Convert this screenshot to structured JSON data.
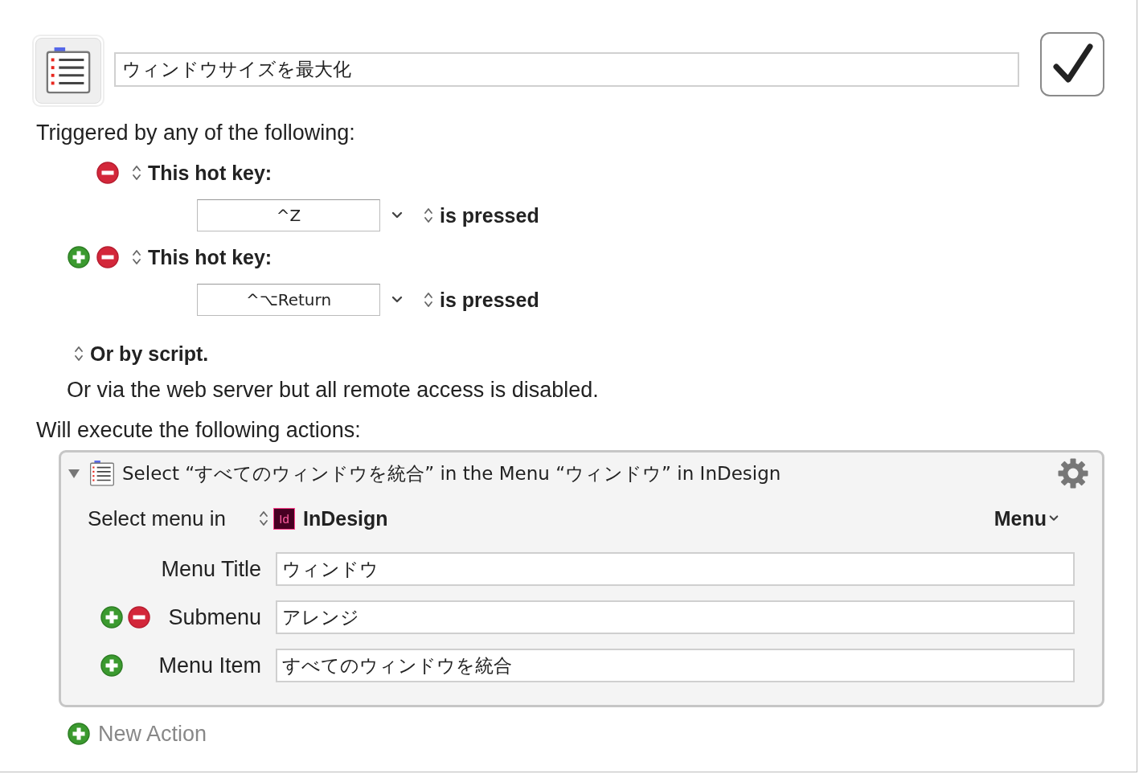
{
  "macro": {
    "name": "ウィンドウサイズを最大化",
    "enabled": true
  },
  "trigger_heading": "Triggered by any of the following:",
  "triggers": [
    {
      "label": "This hot key:",
      "can_add": false,
      "can_remove": true,
      "key": "^Z",
      "condition": "is pressed"
    },
    {
      "label": "This hot key:",
      "can_add": true,
      "can_remove": true,
      "key": "^⌥Return",
      "condition": "is pressed"
    }
  ],
  "script_trigger": "Or by script.",
  "web_server_note": "Or via the web server but all remote access is disabled.",
  "actions_heading": "Will execute the following actions:",
  "actions": [
    {
      "title": "Select “すべてのウィンドウを統合” in the Menu “ウィンドウ” in InDesign",
      "expanded": true,
      "select_label": "Select menu in",
      "app_badge": "Id",
      "app": "InDesign",
      "mode": "Menu",
      "fields": [
        {
          "label": "Menu Title",
          "value": "ウィンドウ",
          "can_add": false,
          "can_remove": false
        },
        {
          "label": "Submenu",
          "value": "アレンジ",
          "can_add": true,
          "can_remove": true
        },
        {
          "label": "Menu Item",
          "value": "すべてのウィンドウを統合",
          "can_add": true,
          "can_remove": false
        }
      ]
    }
  ],
  "new_action": "New Action"
}
